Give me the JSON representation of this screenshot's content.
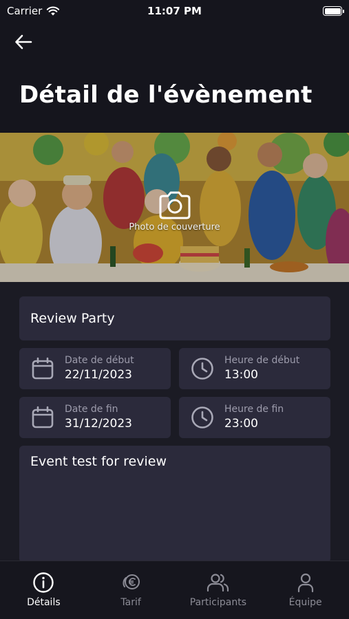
{
  "status_bar": {
    "carrier": "Carrier",
    "time": "11:07 PM"
  },
  "header": {
    "title": "Détail de l'évènement"
  },
  "cover": {
    "label": "Photo de couverture",
    "icon": "camera-icon"
  },
  "event": {
    "name": "Review Party",
    "start_date": {
      "label": "Date de début",
      "value": "22/11/2023",
      "icon": "calendar-icon"
    },
    "start_time": {
      "label": "Heure de début",
      "value": "13:00",
      "icon": "clock-icon"
    },
    "end_date": {
      "label": "Date de fin",
      "value": "31/12/2023",
      "icon": "calendar-icon"
    },
    "end_time": {
      "label": "Heure de fin",
      "value": "23:00",
      "icon": "clock-icon"
    },
    "description": "Event test for review"
  },
  "tabs": [
    {
      "label": "Détails",
      "icon": "info-icon",
      "active": true
    },
    {
      "label": "Tarif",
      "icon": "euro-icon",
      "active": false
    },
    {
      "label": "Participants",
      "icon": "users-icon",
      "active": false
    },
    {
      "label": "Équipe",
      "icon": "user-icon",
      "active": false
    }
  ],
  "colors": {
    "background": "#15151d",
    "card": "#2b2a3b",
    "muted_text": "#9d9cac",
    "inactive_tab": "#8c8c96"
  }
}
